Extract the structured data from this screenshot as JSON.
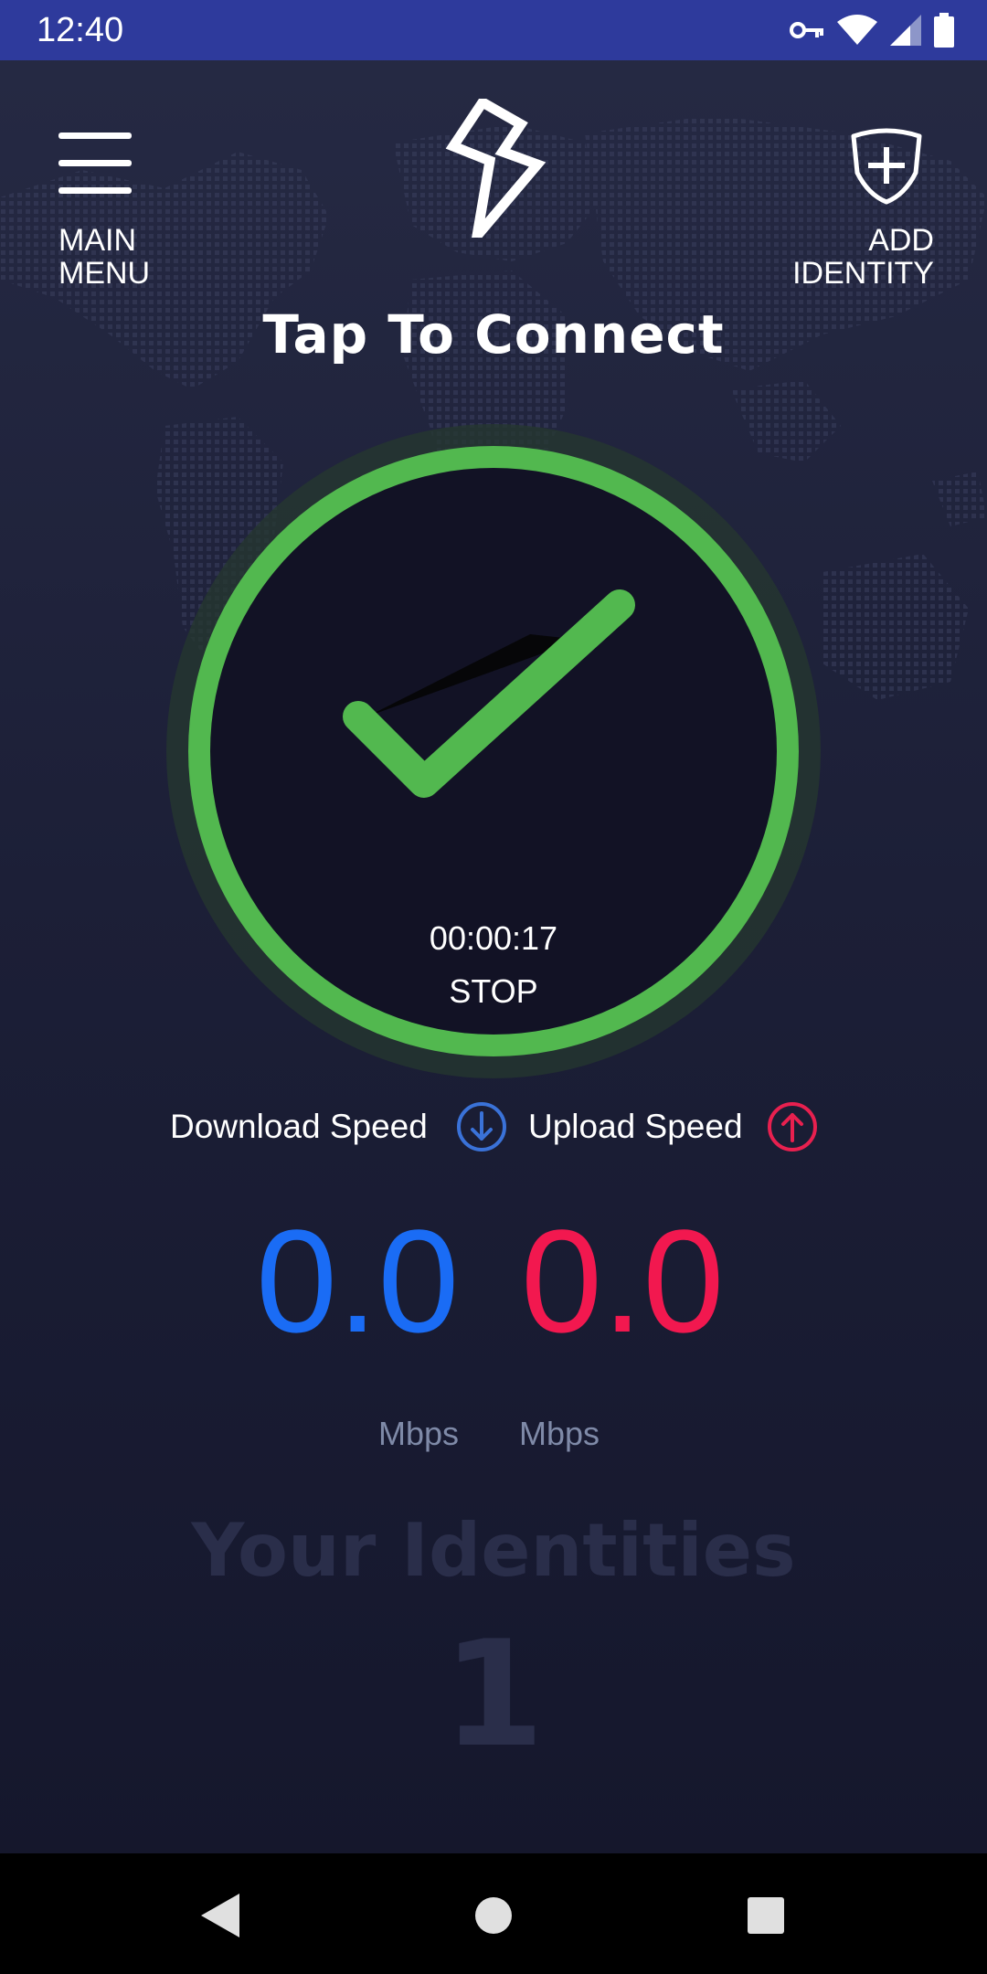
{
  "status_bar": {
    "time": "12:40",
    "icons": [
      "vpn-key-icon",
      "wifi-icon",
      "cellular-signal-icon",
      "battery-icon"
    ]
  },
  "header": {
    "menu_label": "MAIN\nMENU",
    "add_identity_label": "ADD\nIDENTITY",
    "logo_icon": "bolt-logo-icon"
  },
  "connection": {
    "title": "Tap To Connect",
    "timer": "00:00:17",
    "action_label": "STOP",
    "state_icon": "checkmark-icon",
    "ring_color": "#52b84f"
  },
  "speeds": {
    "download_label": "Download Speed",
    "upload_label": "Upload Speed",
    "download_value": "0.0",
    "upload_value": "0.0",
    "download_unit": "Mbps",
    "upload_unit": "Mbps",
    "download_color": "#1a6cf5",
    "upload_color": "#f2184f"
  },
  "identities": {
    "title": "Your Identities",
    "count": "1"
  },
  "nav_bar": {
    "icons": [
      "back-icon",
      "home-icon",
      "recents-icon"
    ]
  }
}
